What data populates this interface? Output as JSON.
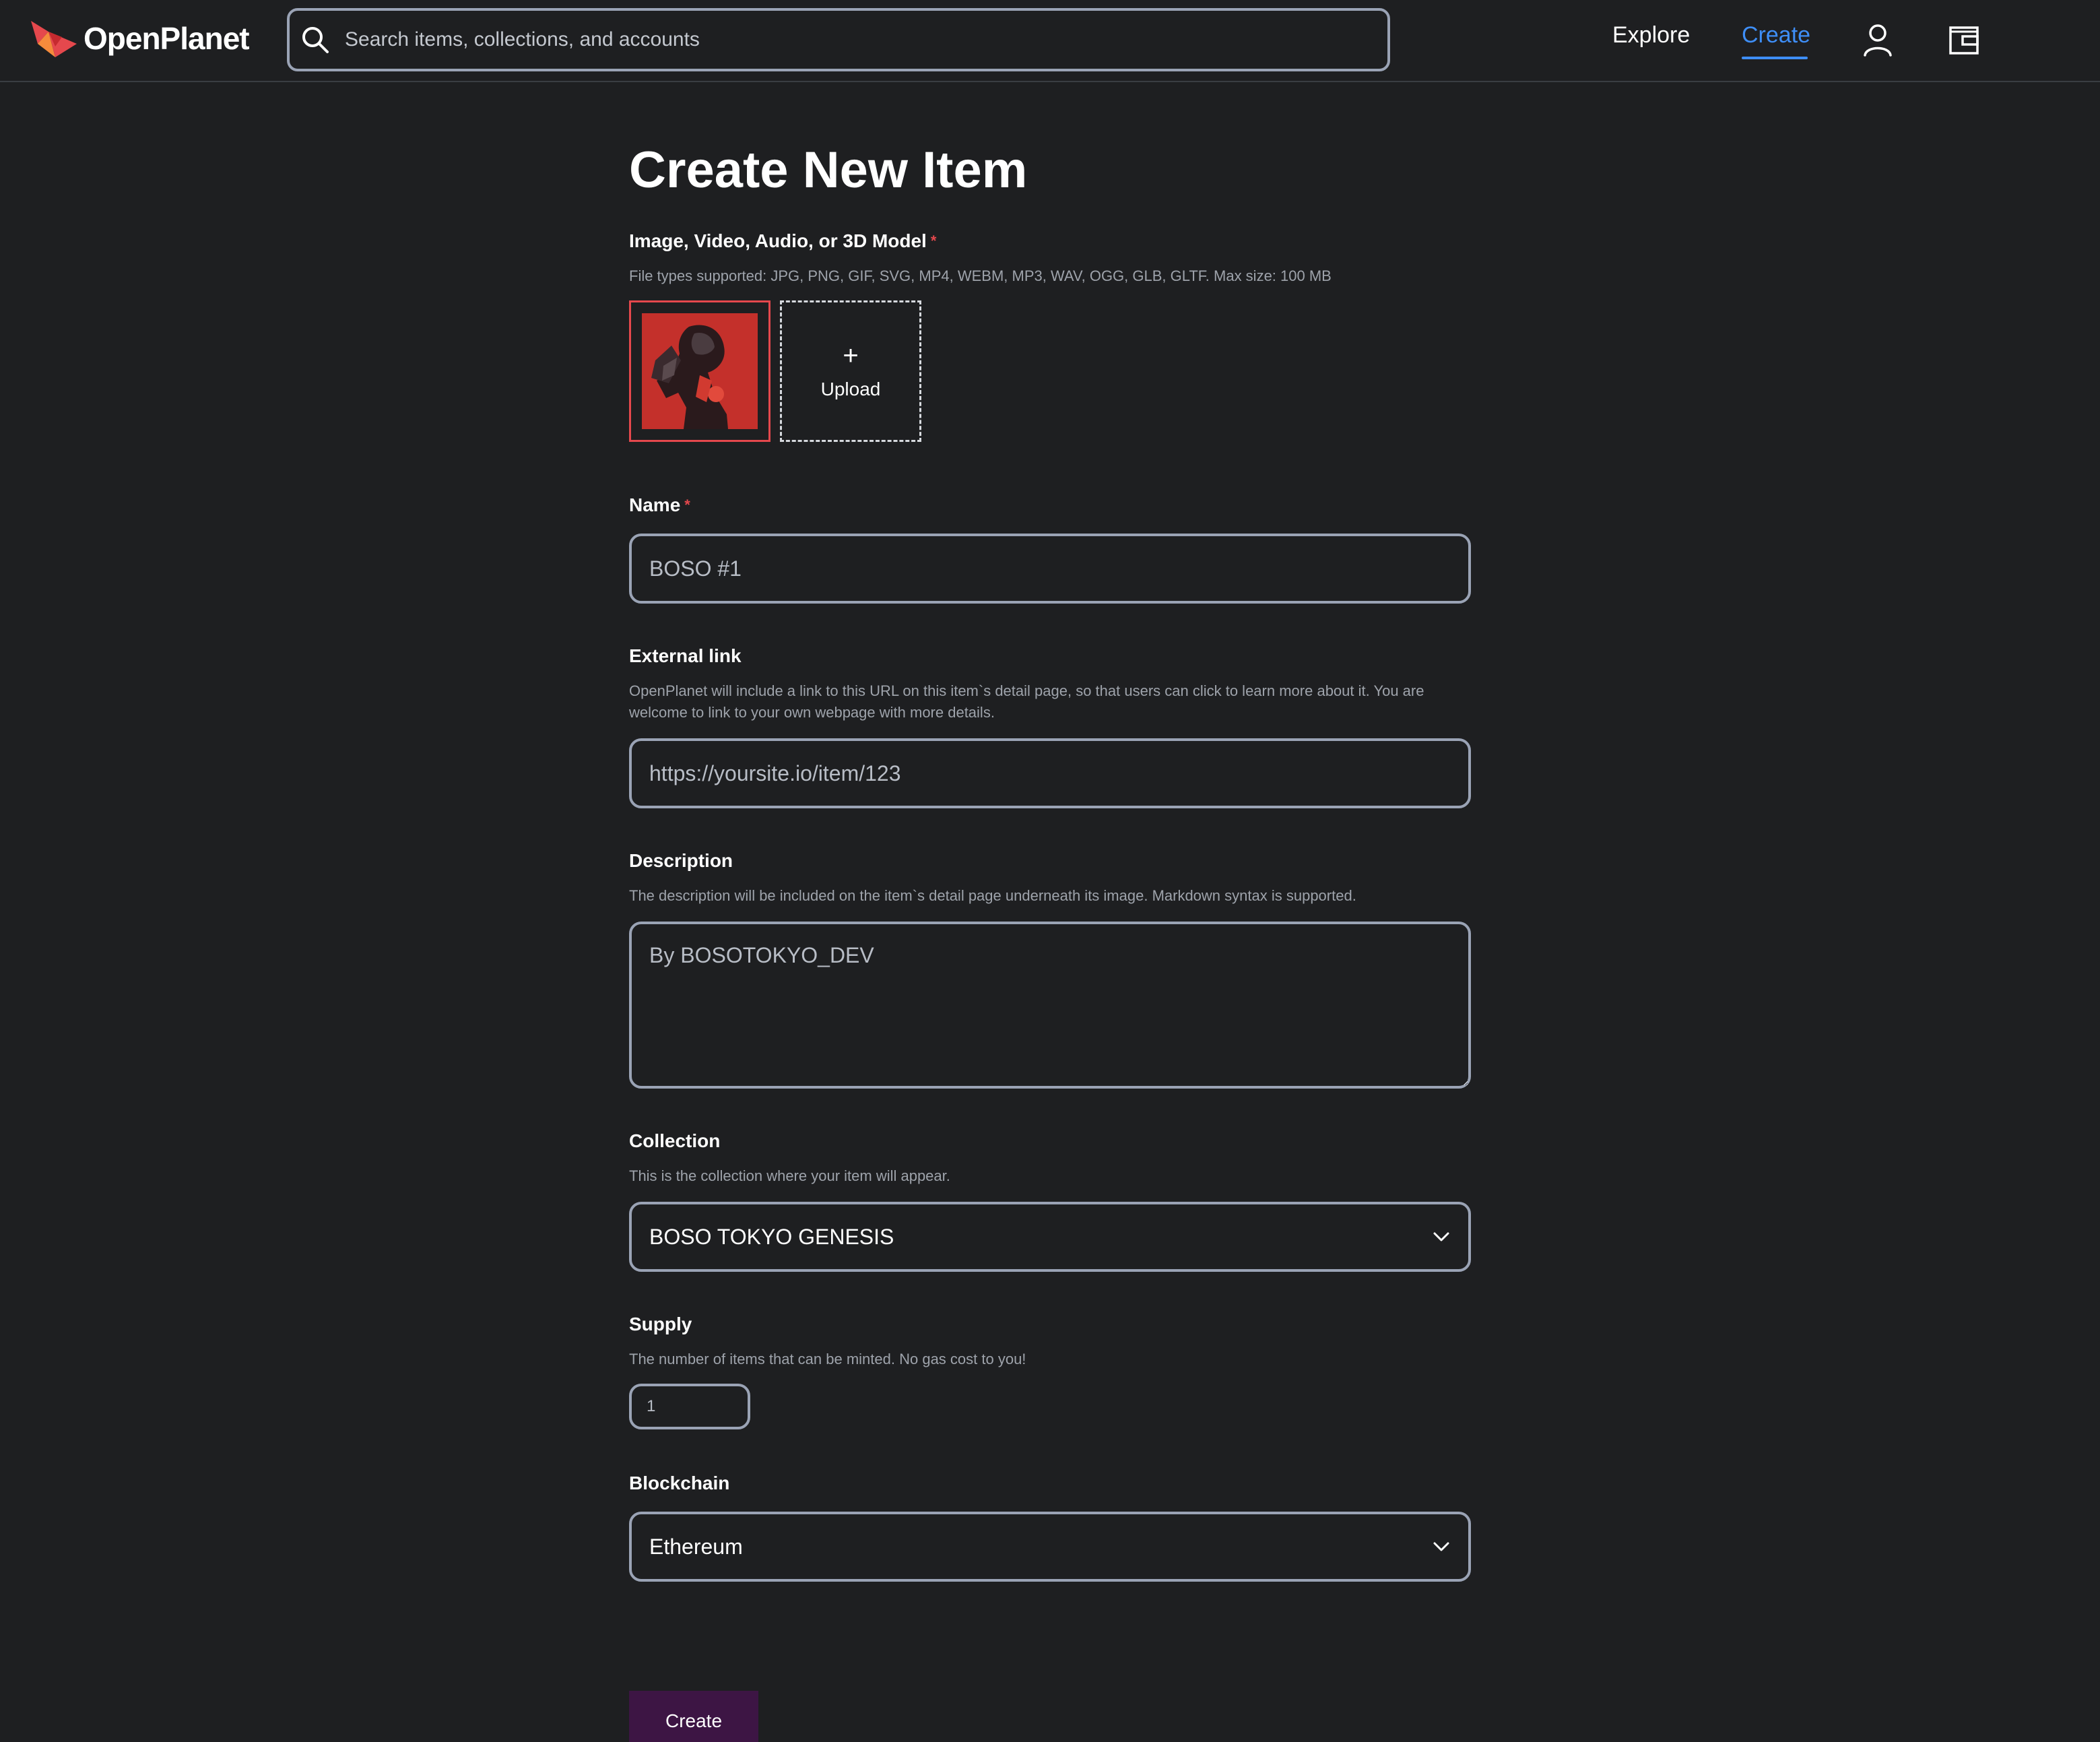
{
  "header": {
    "brand": "OpenPlanet",
    "search_placeholder": "Search items, collections, and accounts",
    "nav": {
      "explore": "Explore",
      "create": "Create"
    }
  },
  "colors": {
    "background": "#1e1f21",
    "accent": "#3e8ef7",
    "required": "#e5484d",
    "button": "#3d1544"
  },
  "form": {
    "title": "Create New Item",
    "media": {
      "label": "Image, Video, Audio, or 3D Model",
      "required_mark": "*",
      "help": "File types supported: JPG, PNG, GIF, SVG, MP4, WEBM, MP3, WAV, OGG, GLB, GLTF. Max size: 100 MB",
      "upload_plus": "+",
      "upload_label": "Upload"
    },
    "name": {
      "label": "Name",
      "required_mark": "*",
      "placeholder": "BOSO #1"
    },
    "external_link": {
      "label": "External link",
      "help": "OpenPlanet will include a link to this URL on this item`s detail page, so that users can click to learn more about it. You are welcome to link to your own webpage with more details.",
      "placeholder": "https://yoursite.io/item/123"
    },
    "description": {
      "label": "Description",
      "help": "The description will be included on the item`s detail page underneath its image. Markdown syntax is supported.",
      "placeholder": "By BOSOTOKYO_DEV"
    },
    "collection": {
      "label": "Collection",
      "help": "This is the collection where your item will appear.",
      "value": "BOSO TOKYO GENESIS"
    },
    "supply": {
      "label": "Supply",
      "help": "The number of items that can be minted. No gas cost to you!",
      "placeholder": "1"
    },
    "blockchain": {
      "label": "Blockchain",
      "value": "Ethereum"
    },
    "submit_label": "Create"
  }
}
